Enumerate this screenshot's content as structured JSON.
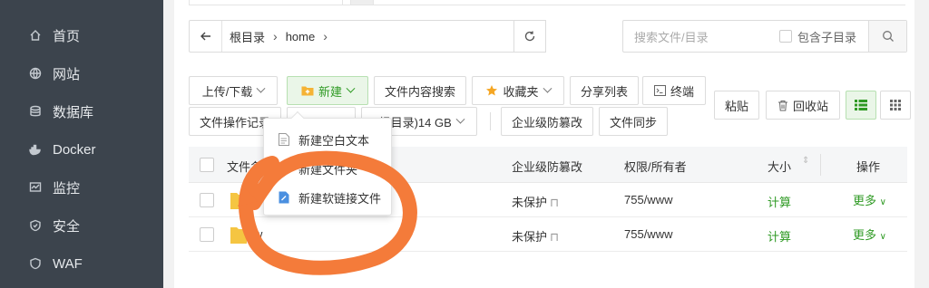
{
  "sidebar": {
    "items": [
      {
        "label": "首页",
        "icon": "home-icon"
      },
      {
        "label": "网站",
        "icon": "globe-icon"
      },
      {
        "label": "数据库",
        "icon": "database-icon"
      },
      {
        "label": "Docker",
        "icon": "docker-icon"
      },
      {
        "label": "监控",
        "icon": "monitor-icon"
      },
      {
        "label": "安全",
        "icon": "shield-icon"
      },
      {
        "label": "WAF",
        "icon": "waf-icon"
      }
    ]
  },
  "address": {
    "crumbs": [
      "根目录",
      "home"
    ]
  },
  "search": {
    "placeholder": "搜索文件/目录",
    "include_sub": "包含子目录"
  },
  "toolbar": {
    "upload": "上传/下载",
    "new": "新建",
    "content_search": "文件内容搜索",
    "favorites": "收藏夹",
    "share_list": "分享列表",
    "terminal": "终端",
    "paste": "粘贴",
    "recycle": "回收站",
    "file_log": "文件操作记录",
    "disk_prefix": "(根目录)14 GB",
    "tamper": "企业级防篡改",
    "sync": "文件同步"
  },
  "table": {
    "headers": {
      "name": "文件名",
      "tamper": "企业级防篡改",
      "perm": "权限/所有者",
      "size": "大小",
      "ops": "操作"
    },
    "rows": [
      {
        "name": "",
        "tamper": "未保护",
        "perm": "755/www",
        "size": "计算",
        "ops": "更多"
      },
      {
        "name": "w",
        "tamper": "未保护",
        "perm": "755/www",
        "size": "计算",
        "ops": "更多"
      }
    ]
  },
  "dropdown": {
    "items": [
      "新建空白文本",
      "新建文件夹",
      "新建软链接文件"
    ]
  },
  "colors": {
    "sidebar": "#3c444d",
    "accent_green": "#2f9a24",
    "annotation_orange": "#f47b3a"
  }
}
